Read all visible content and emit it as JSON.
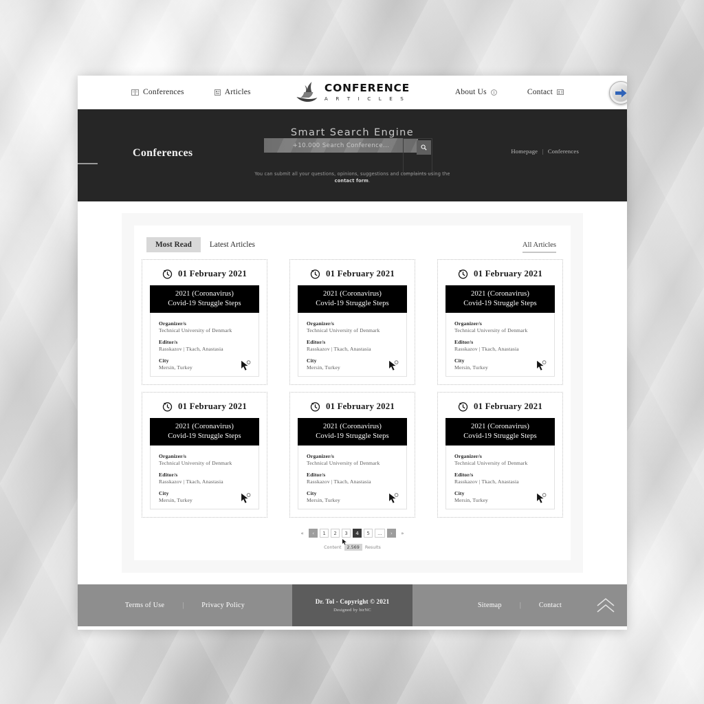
{
  "nav": {
    "left": [
      {
        "label": "Conferences",
        "icon": "book-icon"
      },
      {
        "label": "Articles",
        "icon": "newspaper-icon"
      }
    ],
    "right": [
      {
        "label": "About Us",
        "icon": "info-icon"
      },
      {
        "label": "Contact",
        "icon": "contact-card-icon"
      }
    ],
    "arrow_button_icon": "arrow-right-icon"
  },
  "logo": {
    "main": "CONFERENCE",
    "sub": "A R T I C L E S",
    "mark": "flame-swoosh-logo"
  },
  "hero": {
    "title": "Smart Search Engine",
    "section_label": "Conferences",
    "search_placeholder": "+10.000 Search Conference...",
    "search_value": "",
    "search_icon": "search-icon",
    "note_prefix": "You can submit all your questions, opinions, suggestions and complaints using the ",
    "note_link": "contact form",
    "note_suffix": ".",
    "breadcrumb": {
      "home": "Homepage",
      "separator": "|",
      "current": "Conferences"
    }
  },
  "tabs": {
    "items": [
      {
        "label": "Most Read",
        "active": true
      },
      {
        "label": "Latest Articles",
        "active": false
      }
    ],
    "all_link": "All Articles"
  },
  "card": {
    "date": "01 February 2021",
    "clock_icon": "clock-icon",
    "banner_line1": "2021 (Coronavirus)",
    "banner_line2": "Covid-19 Struggle Steps",
    "organizer_label": "Organizer/s",
    "organizer_value": "Technical University of Denmark",
    "editor_label": "Editor/s",
    "editor_value": "Rasskazov | Tkach, Anastasia",
    "city_label": "City",
    "city_value": "Mersin, Turkey",
    "cursor_icon": "arrow-cursor-icon"
  },
  "cards": [
    {
      "id": 1
    },
    {
      "id": 2
    },
    {
      "id": 3
    },
    {
      "id": 4
    },
    {
      "id": 5
    },
    {
      "id": 6
    }
  ],
  "pagination": {
    "first": "«",
    "prev": "‹",
    "pages": [
      "1",
      "2",
      "3",
      "4",
      "5"
    ],
    "active_page": "4",
    "ellipsis": "...",
    "next": "›",
    "last": "»",
    "result_prefix": "Content",
    "result_count": "2.569",
    "result_suffix": "Results",
    "cursor_icon": "arrow-cursor-icon"
  },
  "footer": {
    "left_links": [
      "Terms of Use",
      "Privacy Policy"
    ],
    "right_links": [
      "Sitemap",
      "Contact"
    ],
    "separator": "|",
    "copyright": "Dr. Tol - Copyright © 2021",
    "designed_by": "Designed by birNC",
    "to_top_icon": "double-chevron-up-icon"
  },
  "colors": {
    "hero_bg": "#262626",
    "banner_bg": "#000000",
    "footer_bg": "#8e8e8e",
    "footer_center_bg": "#5c5c5c",
    "accent_blue": "#2f63b8",
    "active_tab_bg": "#d8d8d8"
  }
}
